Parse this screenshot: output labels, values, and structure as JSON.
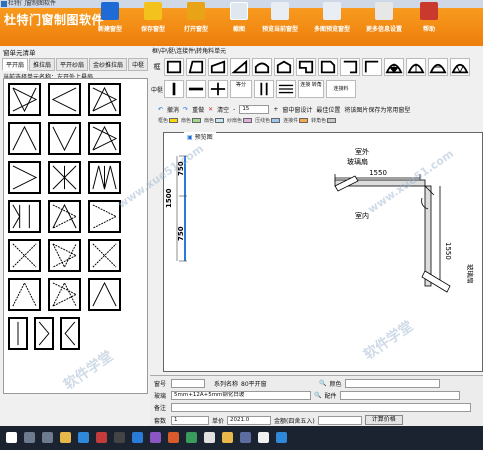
{
  "window": {
    "title": "杜特门窗制图软件"
  },
  "header": {
    "app_title": "杜特门窗制图软件",
    "buttons": [
      {
        "label": "新建窗型",
        "icon": "new-doc-icon",
        "color": "#1e6bd6"
      },
      {
        "label": "保存窗型",
        "icon": "save-folder-icon",
        "color": "#f4c21c"
      },
      {
        "label": "打开窗型",
        "icon": "open-folder-icon",
        "color": "#e8a317"
      },
      {
        "label": "截图",
        "icon": "screenshot-icon",
        "color": "#dfe8ef"
      },
      {
        "label": "预览当前窗型",
        "icon": "preview-icon",
        "color": "#e9eef5"
      },
      {
        "label": "多图预览窗型",
        "icon": "multi-preview-icon",
        "color": "#e9eef5"
      },
      {
        "label": "更多信息设置",
        "icon": "settings-edit-icon",
        "color": "#e7e7e7"
      },
      {
        "label": "帮助",
        "icon": "help-books-icon",
        "color": "#c9392e"
      }
    ]
  },
  "left_panel": {
    "title": "窗单元清单",
    "tabs": [
      "平开扇",
      "推拉扇",
      "平开纱扇",
      "金纱推拉扇",
      "中梃"
    ],
    "current": "当前选择单元名称：左开外上悬扇"
  },
  "right_panel": {
    "shape_label": "框\\中\\梃\\连接件\\转角料单元",
    "row1_label": "框",
    "row2_label": "中梃",
    "row2_texts": [
      "等分",
      "连接\n转角",
      "连接料"
    ],
    "toolbar": [
      "撤消",
      "重做",
      "清空",
      "15",
      "窗中窗设计",
      "最佳位置",
      "将该图片保存为常用窗型"
    ],
    "legend": [
      "框色",
      "扇色",
      "扇色",
      "纱扇色",
      "压线色",
      "连接件",
      "转角色"
    ],
    "canvas_tab": "预览图",
    "dimensions": {
      "d1": "750",
      "d2": "1500",
      "d3": "750",
      "top": "1550",
      "right": "1550"
    },
    "labels": {
      "outdoor": "室外",
      "glass": "玻璃扇",
      "indoor": "室内",
      "glass_right": "玻璃扇"
    }
  },
  "form": {
    "code_label": "窗号",
    "code_value": "",
    "series_label": "系列名称",
    "series_value": "80平开窗",
    "color_label": "颜色",
    "glass_label": "玻璃",
    "glass_value": "5mm+12A+5mm钢化白玻",
    "accessory_label": "配件",
    "note_label": "备注",
    "qty_label": "套数",
    "qty_value": "1",
    "price_label": "单价",
    "price_value": "2021.0",
    "amount_label": "金额(四舍五入)",
    "calc_button": "计算价格"
  },
  "watermark": [
    "软件学堂",
    "www.xue51.com"
  ]
}
